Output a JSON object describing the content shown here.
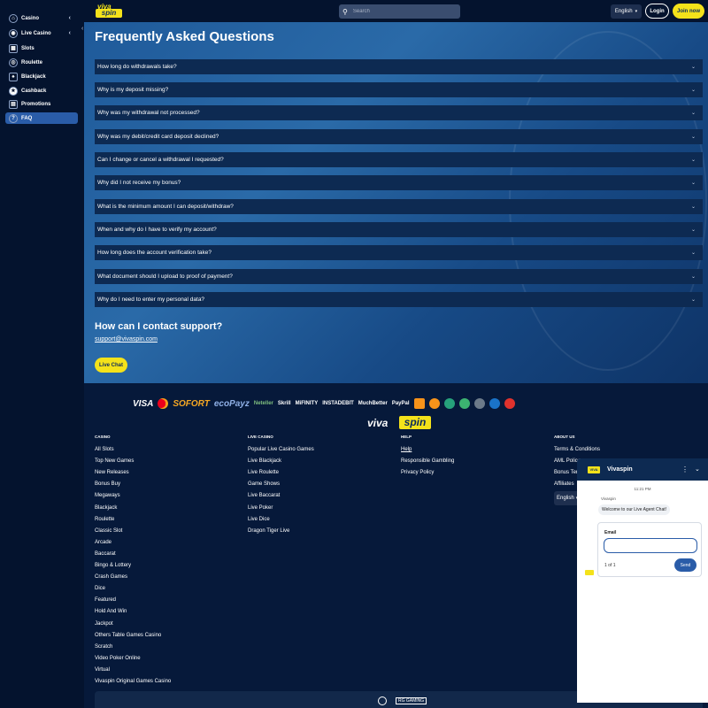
{
  "sidebar": {
    "items": [
      {
        "label": "Casino",
        "icon": "casino-icon",
        "chevron": "‹"
      },
      {
        "label": "Live Casino",
        "icon": "live-casino-icon",
        "chevron": "‹"
      },
      {
        "label": "Slots",
        "icon": "slots-icon"
      },
      {
        "label": "Roulette",
        "icon": "roulette-icon"
      },
      {
        "label": "Blackjack",
        "icon": "blackjack-icon"
      },
      {
        "label": "Cashback",
        "icon": "cashback-icon"
      },
      {
        "label": "Promotions",
        "icon": "promotions-icon"
      },
      {
        "label": "FAQ",
        "icon": "faq-icon",
        "active": true
      }
    ],
    "collapse_glyph": "‹"
  },
  "header": {
    "logo_top": "viva",
    "logo_bottom": "spin",
    "search_placeholder": "Search",
    "language": "English",
    "login": "Login",
    "join": "Join now"
  },
  "faq": {
    "title": "Frequently Asked Questions",
    "questions": [
      "How long do withdrawals take?",
      "Why is my deposit missing?",
      "Why was my withdrawal not processed?",
      "Why was my debit/credit card deposit declined?",
      "Can I change or cancel a withdrawal I requested?",
      "Why did I not receive my bonus?",
      "What is the minimum amount I can deposit/withdraw?",
      "When and why do I have to verify my account?",
      "How long does the account verification take?",
      "What document should I upload to proof of payment?",
      "Why do I need to enter my personal data?"
    ]
  },
  "contact": {
    "title": "How can I contact support?",
    "email": "support@vivaspin.com",
    "live_chat": "Live Chat"
  },
  "payments": [
    "VISA",
    "SOFORT",
    "ecoPayz",
    "Neteller",
    "Skrill",
    "MiFINITY",
    "INSTADEBIT",
    "MuchBetter",
    "PayPal"
  ],
  "footer": {
    "logo_left": "viva",
    "logo_right": "spin",
    "columns": [
      {
        "heading": "CASINO",
        "links": [
          "All Slots",
          "Top New Games",
          "New Releases",
          "Bonus Buy",
          "Megaways",
          "Blackjack",
          "Roulette",
          "Classic Slot",
          "Arcade",
          "Baccarat",
          "Bingo & Lottery",
          "Crash Games",
          "Dice",
          "Featured",
          "Hold And Win",
          "Jackpot",
          "Others Table Games Casino",
          "Scratch",
          "Video Poker Online",
          "Virtual",
          "Vivaspin Original Games Casino"
        ]
      },
      {
        "heading": "LIVE CASINO",
        "links": [
          "Popular Live Casino Games",
          "Live Blackjack",
          "Live Roulette",
          "Game Shows",
          "Live Baccarat",
          "Live Poker",
          "Live Dice",
          "Dragon Tiger Live"
        ]
      },
      {
        "heading": "HELP",
        "links": [
          "Help",
          "Responsible Gambling",
          "Privacy Policy"
        ]
      },
      {
        "heading": "ABOUT US",
        "links": [
          "Terms & Conditions",
          "AML Polic",
          "Bonus Ter",
          "Affiliates"
        ]
      }
    ],
    "language": "English",
    "provider_badge": "RG GAMING"
  },
  "chat": {
    "title": "Vivaspin",
    "time": "11:21 PM",
    "agent": "Vivaspin",
    "welcome": "Welcome to our Live Agent Chat!",
    "email_label": "Email",
    "pager": "1  of  1",
    "send": "Send"
  },
  "colors": {
    "accent": "#f4e21a",
    "sidebar_bg": "#04132e",
    "faq_row": "#0d2a52",
    "active": "#2a5ca8"
  }
}
